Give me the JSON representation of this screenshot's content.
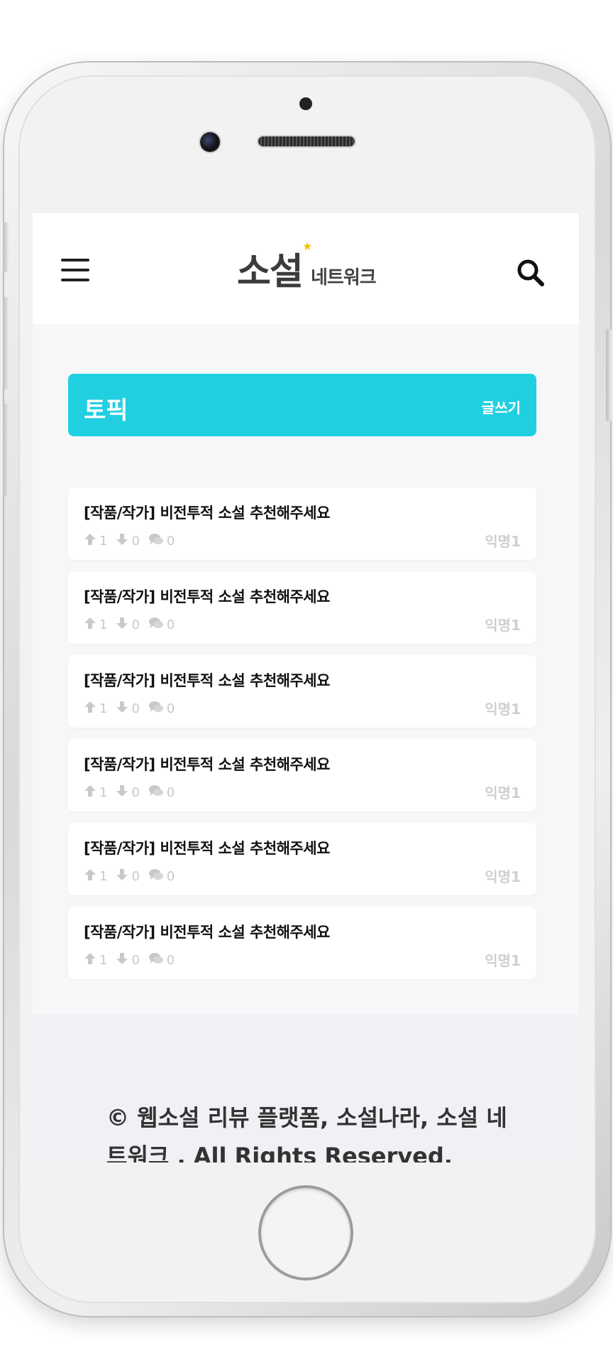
{
  "header": {
    "logo_main": "소설",
    "logo_sub": "네트워크"
  },
  "section": {
    "title": "토픽",
    "write_label": "글쓰기"
  },
  "posts": [
    {
      "title": "[작품/작가] 비전투적 소설 추천해주세요",
      "up": "1",
      "down": "0",
      "comments": "0",
      "author": "익명1"
    },
    {
      "title": "[작품/작가] 비전투적 소설 추천해주세요",
      "up": "1",
      "down": "0",
      "comments": "0",
      "author": "익명1"
    },
    {
      "title": "[작품/작가] 비전투적 소설 추천해주세요",
      "up": "1",
      "down": "0",
      "comments": "0",
      "author": "익명1"
    },
    {
      "title": "[작품/작가] 비전투적 소설 추천해주세요",
      "up": "1",
      "down": "0",
      "comments": "0",
      "author": "익명1"
    },
    {
      "title": "[작품/작가] 비전투적 소설 추천해주세요",
      "up": "1",
      "down": "0",
      "comments": "0",
      "author": "익명1"
    },
    {
      "title": "[작품/작가] 비전투적 소설 추천해주세요",
      "up": "1",
      "down": "0",
      "comments": "0",
      "author": "익명1"
    }
  ],
  "footer": {
    "copyright": "© 웹소설 리뷰 플랫폼, 소설나라, 소설 네트워크 . All Rights Reserved."
  },
  "colors": {
    "accent": "#21d0e0",
    "meta": "#c9c9c9"
  },
  "icons": [
    "menu-icon",
    "search-icon",
    "arrow-up-icon",
    "arrow-down-icon",
    "comment-icon"
  ]
}
